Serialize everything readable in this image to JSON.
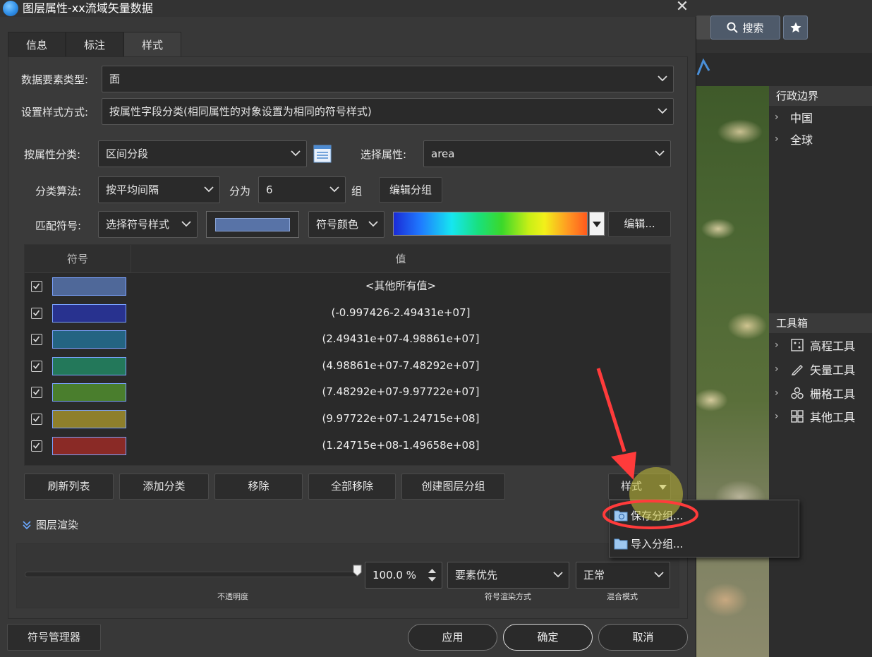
{
  "background_app": {
    "search_label": "搜索",
    "admin_boundary": {
      "header": "行政边界",
      "items": [
        "中国",
        "全球"
      ]
    },
    "toolbox": {
      "header": "工具箱",
      "items": [
        "高程工具",
        "矢量工具",
        "栅格工具",
        "其他工具"
      ]
    }
  },
  "dialog": {
    "title": "图层属性-xx流域矢量数据",
    "close_glyph": "✕",
    "tabs": [
      "信息",
      "标注",
      "样式"
    ],
    "active_tab": "样式",
    "feature_type": {
      "label": "数据要素类型:",
      "value": "面"
    },
    "style_mode": {
      "label": "设置样式方式:",
      "value": "按属性字段分类(相同属性的对象设置为相同的符号样式)"
    },
    "classify_by": {
      "label": "按属性分类:",
      "value": "区间分段"
    },
    "attribute": {
      "label": "选择属性:",
      "value": "area"
    },
    "algorithm": {
      "label": "分类算法:",
      "value": "按平均间隔"
    },
    "split": {
      "label": "分为",
      "value": "6",
      "suffix": "组"
    },
    "edit_groups": "编辑分组",
    "match_symbol": {
      "label": "匹配符号:",
      "value": "选择符号样式"
    },
    "symbol_color": "符号颜色",
    "edit_button": "编辑...",
    "table": {
      "headers": [
        "符号",
        "值"
      ],
      "rows": [
        {
          "checked": true,
          "color": "#4f6899",
          "value": "<其他所有值>"
        },
        {
          "checked": true,
          "color": "#28328f",
          "value": "(-0.997426-2.49431e+07]"
        },
        {
          "checked": true,
          "color": "#246482",
          "value": "(2.49431e+07-4.98861e+07]"
        },
        {
          "checked": true,
          "color": "#23785a",
          "value": "(4.98861e+07-7.48292e+07]"
        },
        {
          "checked": true,
          "color": "#4a7e2d",
          "value": "(7.48292e+07-9.97722e+07]"
        },
        {
          "checked": true,
          "color": "#8e7f2b",
          "value": "(9.97722e+07-1.24715e+08]"
        },
        {
          "checked": true,
          "color": "#8a2a26",
          "value": "(1.24715e+08-1.49658e+08]"
        }
      ]
    },
    "actions": [
      "刷新列表",
      "添加分类",
      "移除",
      "全部移除",
      "创建图层分组"
    ],
    "style_button": "样式",
    "style_menu": [
      "保存分组...",
      "导入分组..."
    ],
    "render": {
      "header": "图层渲染",
      "opacity_value": "100.0 %",
      "opacity_level": 1.0,
      "opacity_caption": "不透明度",
      "render_mode": "要素优先",
      "render_mode_caption": "符号渲染方式",
      "blend_mode": "正常",
      "blend_mode_caption": "混合模式"
    },
    "symbol_manager": "符号管理器",
    "footer": {
      "apply": "应用",
      "ok": "确定",
      "cancel": "取消"
    }
  }
}
